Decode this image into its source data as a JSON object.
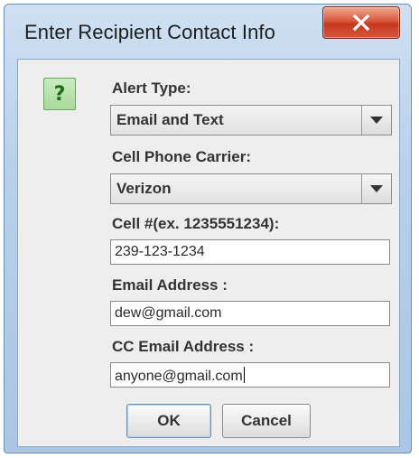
{
  "dialog": {
    "title": "Enter Recipient Contact Info",
    "icon": "question-icon",
    "icon_glyph": "?",
    "close_icon": "close-icon"
  },
  "form": {
    "alert_type": {
      "label": "Alert Type:",
      "value": "Email and Text"
    },
    "carrier": {
      "label": "Cell Phone Carrier:",
      "value": "Verizon"
    },
    "cell": {
      "label": "Cell #(ex. 1235551234):",
      "value": "239-123-1234"
    },
    "email": {
      "label": "Email Address :",
      "value": "dew@gmail.com"
    },
    "cc_email": {
      "label": "CC Email Address :",
      "value": "anyone@gmail.com"
    }
  },
  "buttons": {
    "ok": "OK",
    "cancel": "Cancel"
  },
  "colors": {
    "title_bar": "#b9d1ea",
    "close_button": "#c5391f",
    "question_icon": "#a9d99b",
    "panel": "#eeeeee"
  }
}
